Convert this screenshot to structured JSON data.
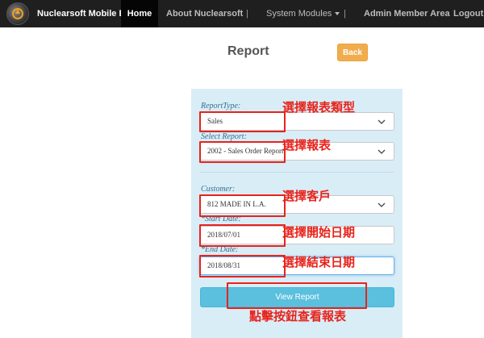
{
  "navbar": {
    "brand": "Nuclearsoft Mobile ERP",
    "home": "Home",
    "about": "About Nuclearsoft",
    "separator": "|",
    "modules": "System Modules",
    "admin": "Admin Member Area",
    "logout": "Logout"
  },
  "page": {
    "title": "Report",
    "back_label": "Back"
  },
  "form": {
    "report_type_label": "ReportType:",
    "report_type_value": "Sales",
    "select_report_label": "Select Report:",
    "select_report_value": "2002 - Sales Order Report",
    "customer_label": "Customer:",
    "customer_value": "812 MADE IN L.A.",
    "start_date_label": "*Start Date:",
    "start_date_value": "2018/07/01",
    "end_date_label": "*End Date:",
    "end_date_value": "2018/08/31",
    "view_report_label": "View Report"
  },
  "annotations": {
    "report_type": "選擇報表類型",
    "select_report": "選擇報表",
    "customer": "選擇客戶",
    "start_date": "選擇開始日期",
    "end_date": "選擇結束日期",
    "view_report": "點擊按鈕查看報表"
  },
  "colors": {
    "navbar_bg": "#1f1f1f",
    "back_button": "#f0ad4e",
    "panel_bg": "#d9edf7",
    "view_button": "#5bc0de",
    "annotation_red": "#e8231b"
  }
}
